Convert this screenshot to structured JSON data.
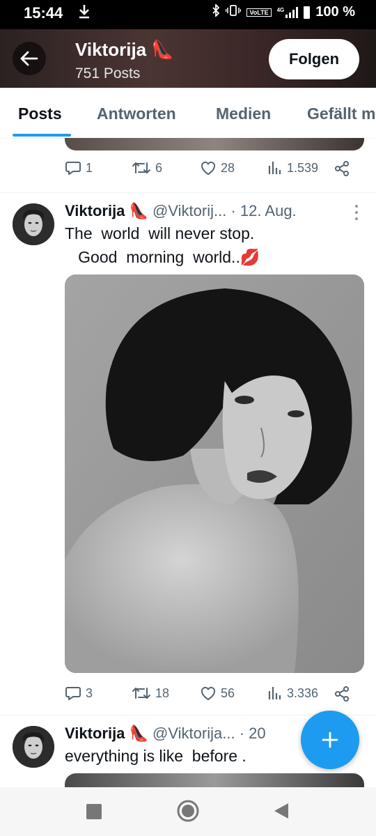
{
  "status_bar": {
    "time": "15:44",
    "download_icon": "download-icon",
    "bluetooth_icon": "bluetooth-icon",
    "vibrate_icon": "vibrate-icon",
    "volte": "VoLTE",
    "network": "4G",
    "battery": "100 %"
  },
  "header": {
    "name": "Viktorija 👠",
    "posts_count": "751 Posts",
    "follow_label": "Folgen"
  },
  "tabs": [
    "Posts",
    "Antworten",
    "Medien",
    "Gefällt mir"
  ],
  "prev_tweet": {
    "replies": "1",
    "retweets": "6",
    "likes": "28",
    "views": "1.539"
  },
  "tweet": {
    "name": "Viktorija 👠",
    "handle": "@Viktorij...",
    "separator": "·",
    "date": "12. Aug.",
    "text_line1": "The  world  will never stop.",
    "text_line2": "   Good  morning  world..💋",
    "replies": "3",
    "retweets": "18",
    "likes": "56",
    "views": "3.336"
  },
  "next_tweet": {
    "name": "Viktorija 👠",
    "handle": "@Viktorija...",
    "separator": "·",
    "date": "20",
    "text": "everything is like  before ."
  },
  "colors": {
    "accent": "#1d9bf0",
    "muted": "#536471",
    "text": "#0f1419"
  }
}
